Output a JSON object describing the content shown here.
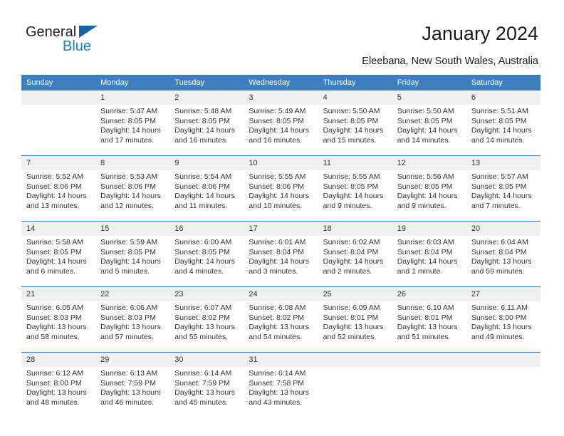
{
  "brand": {
    "name_part1": "General",
    "name_part2": "Blue",
    "accent_color": "#1a7fc1",
    "triangle_color": "#1565a8"
  },
  "header": {
    "title": "January 2024",
    "location": "Eleebana, New South Wales, Australia",
    "header_bg": "#3d7ebf",
    "numband_bg": "#f0f0f0"
  },
  "weekdays": [
    "Sunday",
    "Monday",
    "Tuesday",
    "Wednesday",
    "Thursday",
    "Friday",
    "Saturday"
  ],
  "weeks": [
    [
      {
        "day": "",
        "sunrise": "",
        "sunset": "",
        "daylight1": "",
        "daylight2": ""
      },
      {
        "day": "1",
        "sunrise": "Sunrise: 5:47 AM",
        "sunset": "Sunset: 8:05 PM",
        "daylight1": "Daylight: 14 hours",
        "daylight2": "and 17 minutes."
      },
      {
        "day": "2",
        "sunrise": "Sunrise: 5:48 AM",
        "sunset": "Sunset: 8:05 PM",
        "daylight1": "Daylight: 14 hours",
        "daylight2": "and 16 minutes."
      },
      {
        "day": "3",
        "sunrise": "Sunrise: 5:49 AM",
        "sunset": "Sunset: 8:05 PM",
        "daylight1": "Daylight: 14 hours",
        "daylight2": "and 16 minutes."
      },
      {
        "day": "4",
        "sunrise": "Sunrise: 5:50 AM",
        "sunset": "Sunset: 8:05 PM",
        "daylight1": "Daylight: 14 hours",
        "daylight2": "and 15 minutes."
      },
      {
        "day": "5",
        "sunrise": "Sunrise: 5:50 AM",
        "sunset": "Sunset: 8:05 PM",
        "daylight1": "Daylight: 14 hours",
        "daylight2": "and 14 minutes."
      },
      {
        "day": "6",
        "sunrise": "Sunrise: 5:51 AM",
        "sunset": "Sunset: 8:05 PM",
        "daylight1": "Daylight: 14 hours",
        "daylight2": "and 14 minutes."
      }
    ],
    [
      {
        "day": "7",
        "sunrise": "Sunrise: 5:52 AM",
        "sunset": "Sunset: 8:06 PM",
        "daylight1": "Daylight: 14 hours",
        "daylight2": "and 13 minutes."
      },
      {
        "day": "8",
        "sunrise": "Sunrise: 5:53 AM",
        "sunset": "Sunset: 8:06 PM",
        "daylight1": "Daylight: 14 hours",
        "daylight2": "and 12 minutes."
      },
      {
        "day": "9",
        "sunrise": "Sunrise: 5:54 AM",
        "sunset": "Sunset: 8:06 PM",
        "daylight1": "Daylight: 14 hours",
        "daylight2": "and 11 minutes."
      },
      {
        "day": "10",
        "sunrise": "Sunrise: 5:55 AM",
        "sunset": "Sunset: 8:06 PM",
        "daylight1": "Daylight: 14 hours",
        "daylight2": "and 10 minutes."
      },
      {
        "day": "11",
        "sunrise": "Sunrise: 5:55 AM",
        "sunset": "Sunset: 8:05 PM",
        "daylight1": "Daylight: 14 hours",
        "daylight2": "and 9 minutes."
      },
      {
        "day": "12",
        "sunrise": "Sunrise: 5:56 AM",
        "sunset": "Sunset: 8:05 PM",
        "daylight1": "Daylight: 14 hours",
        "daylight2": "and 9 minutes."
      },
      {
        "day": "13",
        "sunrise": "Sunrise: 5:57 AM",
        "sunset": "Sunset: 8:05 PM",
        "daylight1": "Daylight: 14 hours",
        "daylight2": "and 7 minutes."
      }
    ],
    [
      {
        "day": "14",
        "sunrise": "Sunrise: 5:58 AM",
        "sunset": "Sunset: 8:05 PM",
        "daylight1": "Daylight: 14 hours",
        "daylight2": "and 6 minutes."
      },
      {
        "day": "15",
        "sunrise": "Sunrise: 5:59 AM",
        "sunset": "Sunset: 8:05 PM",
        "daylight1": "Daylight: 14 hours",
        "daylight2": "and 5 minutes."
      },
      {
        "day": "16",
        "sunrise": "Sunrise: 6:00 AM",
        "sunset": "Sunset: 8:05 PM",
        "daylight1": "Daylight: 14 hours",
        "daylight2": "and 4 minutes."
      },
      {
        "day": "17",
        "sunrise": "Sunrise: 6:01 AM",
        "sunset": "Sunset: 8:04 PM",
        "daylight1": "Daylight: 14 hours",
        "daylight2": "and 3 minutes."
      },
      {
        "day": "18",
        "sunrise": "Sunrise: 6:02 AM",
        "sunset": "Sunset: 8:04 PM",
        "daylight1": "Daylight: 14 hours",
        "daylight2": "and 2 minutes."
      },
      {
        "day": "19",
        "sunrise": "Sunrise: 6:03 AM",
        "sunset": "Sunset: 8:04 PM",
        "daylight1": "Daylight: 14 hours",
        "daylight2": "and 1 minute."
      },
      {
        "day": "20",
        "sunrise": "Sunrise: 6:04 AM",
        "sunset": "Sunset: 8:04 PM",
        "daylight1": "Daylight: 13 hours",
        "daylight2": "and 59 minutes."
      }
    ],
    [
      {
        "day": "21",
        "sunrise": "Sunrise: 6:05 AM",
        "sunset": "Sunset: 8:03 PM",
        "daylight1": "Daylight: 13 hours",
        "daylight2": "and 58 minutes."
      },
      {
        "day": "22",
        "sunrise": "Sunrise: 6:06 AM",
        "sunset": "Sunset: 8:03 PM",
        "daylight1": "Daylight: 13 hours",
        "daylight2": "and 57 minutes."
      },
      {
        "day": "23",
        "sunrise": "Sunrise: 6:07 AM",
        "sunset": "Sunset: 8:02 PM",
        "daylight1": "Daylight: 13 hours",
        "daylight2": "and 55 minutes."
      },
      {
        "day": "24",
        "sunrise": "Sunrise: 6:08 AM",
        "sunset": "Sunset: 8:02 PM",
        "daylight1": "Daylight: 13 hours",
        "daylight2": "and 54 minutes."
      },
      {
        "day": "25",
        "sunrise": "Sunrise: 6:09 AM",
        "sunset": "Sunset: 8:01 PM",
        "daylight1": "Daylight: 13 hours",
        "daylight2": "and 52 minutes."
      },
      {
        "day": "26",
        "sunrise": "Sunrise: 6:10 AM",
        "sunset": "Sunset: 8:01 PM",
        "daylight1": "Daylight: 13 hours",
        "daylight2": "and 51 minutes."
      },
      {
        "day": "27",
        "sunrise": "Sunrise: 6:11 AM",
        "sunset": "Sunset: 8:00 PM",
        "daylight1": "Daylight: 13 hours",
        "daylight2": "and 49 minutes."
      }
    ],
    [
      {
        "day": "28",
        "sunrise": "Sunrise: 6:12 AM",
        "sunset": "Sunset: 8:00 PM",
        "daylight1": "Daylight: 13 hours",
        "daylight2": "and 48 minutes."
      },
      {
        "day": "29",
        "sunrise": "Sunrise: 6:13 AM",
        "sunset": "Sunset: 7:59 PM",
        "daylight1": "Daylight: 13 hours",
        "daylight2": "and 46 minutes."
      },
      {
        "day": "30",
        "sunrise": "Sunrise: 6:14 AM",
        "sunset": "Sunset: 7:59 PM",
        "daylight1": "Daylight: 13 hours",
        "daylight2": "and 45 minutes."
      },
      {
        "day": "31",
        "sunrise": "Sunrise: 6:14 AM",
        "sunset": "Sunset: 7:58 PM",
        "daylight1": "Daylight: 13 hours",
        "daylight2": "and 43 minutes."
      },
      {
        "day": "",
        "sunrise": "",
        "sunset": "",
        "daylight1": "",
        "daylight2": ""
      },
      {
        "day": "",
        "sunrise": "",
        "sunset": "",
        "daylight1": "",
        "daylight2": ""
      },
      {
        "day": "",
        "sunrise": "",
        "sunset": "",
        "daylight1": "",
        "daylight2": ""
      }
    ]
  ]
}
